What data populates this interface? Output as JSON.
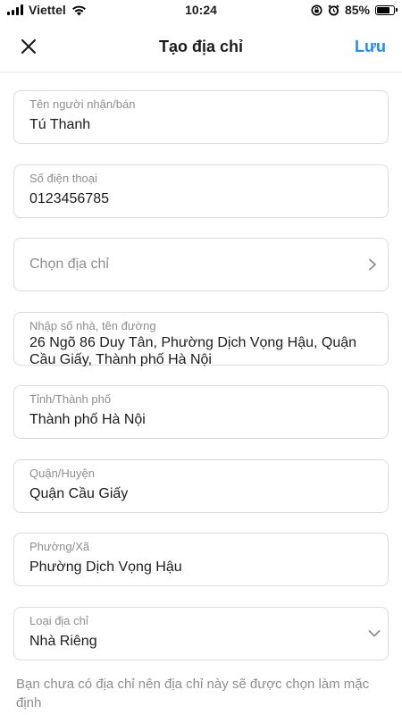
{
  "status_bar": {
    "carrier": "Viettel",
    "time": "10:24",
    "battery_percent": "85%",
    "battery_level": 0.85,
    "icons": [
      "signal-icon",
      "wifi-icon",
      "rotation-lock-icon",
      "alarm-icon",
      "battery-icon"
    ]
  },
  "nav": {
    "title": "Tạo địa chỉ",
    "save_label": "Lưu",
    "close_icon": "close-icon"
  },
  "form": {
    "recipient": {
      "label": "Tên người nhận/bán",
      "value": "Tú Thanh"
    },
    "phone": {
      "label": "Số điện thoại",
      "value": "0123456785"
    },
    "address_picker": {
      "placeholder": "Chọn địa chỉ",
      "icon": "chevron-right-icon"
    },
    "street": {
      "label": "Nhập số nhà, tên đường",
      "value": "26 Ngõ 86 Duy Tân, Phường Dịch Vọng Hậu, Quận Cầu Giấy, Thành phố Hà Nội"
    },
    "province": {
      "label": "Tỉnh/Thành phố",
      "value": "Thành phố Hà Nội"
    },
    "district": {
      "label": "Quận/Huyện",
      "value": "Quận Cầu Giấy"
    },
    "ward": {
      "label": "Phường/Xã",
      "value": "Phường Dịch Vọng Hậu"
    },
    "address_type": {
      "label": "Loại địa chỉ",
      "value": "Nhà Riêng",
      "icon": "chevron-down-icon"
    }
  },
  "note": "Bạn chưa có địa chỉ nên địa chỉ này sẽ được chọn làm mặc định",
  "colors": {
    "accent": "#1a8cff",
    "background": "#f2f2f5",
    "border": "#dcdce0",
    "label": "#8e8e93"
  }
}
